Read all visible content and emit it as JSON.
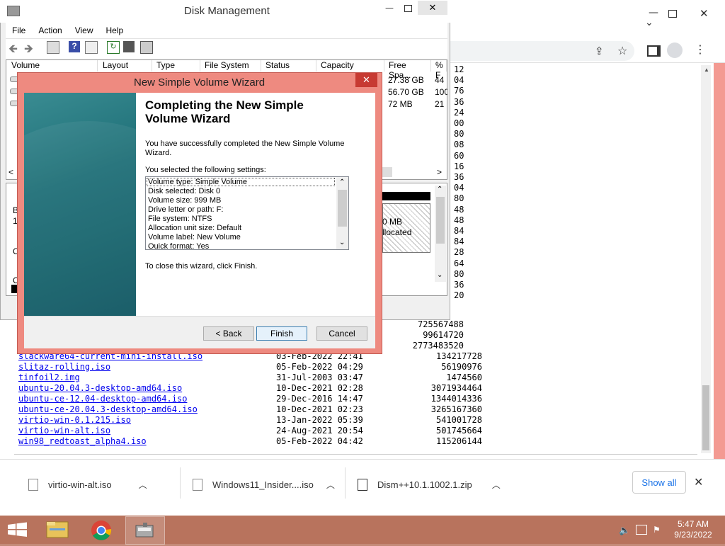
{
  "disk_management": {
    "title": "Disk Management",
    "menu": [
      "File",
      "Action",
      "View",
      "Help"
    ],
    "columns": [
      "Volume",
      "Layout",
      "Type",
      "File System",
      "Status",
      "Capacity",
      "Free Spa...",
      "% F"
    ],
    "free_space": [
      "27.38 GB",
      "56.70 GB",
      "72 MB"
    ],
    "pct_free": [
      "44",
      "100",
      "21"
    ],
    "partial_text": {
      "mb": "0 MB",
      "allocated": "llocated",
      "left_b": "B",
      "left_1": "1.",
      "left_c": "C",
      "left_c2": "C"
    }
  },
  "wizard": {
    "title": "New Simple Volume Wizard",
    "heading_line1": "Completing the New Simple",
    "heading_line2": "Volume Wizard",
    "intro_line1": "You have successfully completed the New Simple Volume",
    "intro_line2": "Wizard.",
    "settings_label": "You selected the following settings:",
    "settings": [
      "Volume type: Simple Volume",
      "Disk selected: Disk 0",
      "Volume size: 999 MB",
      "Drive letter or path: F:",
      "File system: NTFS",
      "Allocation unit size: Default",
      "Volume label: New Volume",
      "Quick format: Yes"
    ],
    "close_hint": "To close this wizard, click Finish.",
    "back_label": "< Back",
    "finish_label": "Finish",
    "cancel_label": "Cancel"
  },
  "browser": {
    "truncated_numbers": [
      "12",
      "04",
      "76",
      "36",
      "24",
      "00",
      "80",
      "08",
      "60",
      "16",
      "36",
      "04",
      "80",
      "48",
      "48",
      "84",
      "84",
      "28",
      "64",
      "80",
      "36",
      "20"
    ],
    "sizes_only": [
      "725567488",
      "99614720",
      "2773483520"
    ],
    "files": [
      {
        "name": "slackware64-current-mini-install.iso",
        "date": "03-Feb-2022 22:41",
        "size": "134217728"
      },
      {
        "name": "slitaz-rolling.iso",
        "date": "05-Feb-2022 04:29",
        "size": "56190976"
      },
      {
        "name": "tinfoil2.img",
        "date": "31-Jul-2003 03:47",
        "size": "1474560"
      },
      {
        "name": "ubuntu-20.04.3-desktop-amd64.iso",
        "date": "10-Dec-2021 02:28",
        "size": "3071934464"
      },
      {
        "name": "ubuntu-ce-12.04-desktop-amd64.iso",
        "date": "29-Dec-2016 14:47",
        "size": "1344014336"
      },
      {
        "name": "ubuntu-ce-20.04.3-desktop-amd64.iso",
        "date": "10-Dec-2021 02:23",
        "size": "3265167360"
      },
      {
        "name": "virtio-win-0.1.215.iso",
        "date": "13-Jan-2022 05:39",
        "size": "541001728"
      },
      {
        "name": "virtio-win-alt.iso",
        "date": "24-Aug-2021 20:54",
        "size": "501745664"
      },
      {
        "name": "win98_redtoast_alpha4.iso",
        "date": "05-Feb-2022 04:42",
        "size": "115206144"
      }
    ],
    "downloads": [
      "virtio-win-alt.iso",
      "Windows11_Insider....iso",
      "Dism++10.1.1002.1.zip"
    ],
    "show_all_label": "Show all"
  },
  "taskbar": {
    "time": "5:47 AM",
    "date": "9/23/2022"
  },
  "colors": {
    "link": "#0000ee",
    "wizard_frame": "#ee8a80",
    "close_red": "#c73a32",
    "taskbar": "#b8735d",
    "chrome_blue": "#1a73e8"
  }
}
